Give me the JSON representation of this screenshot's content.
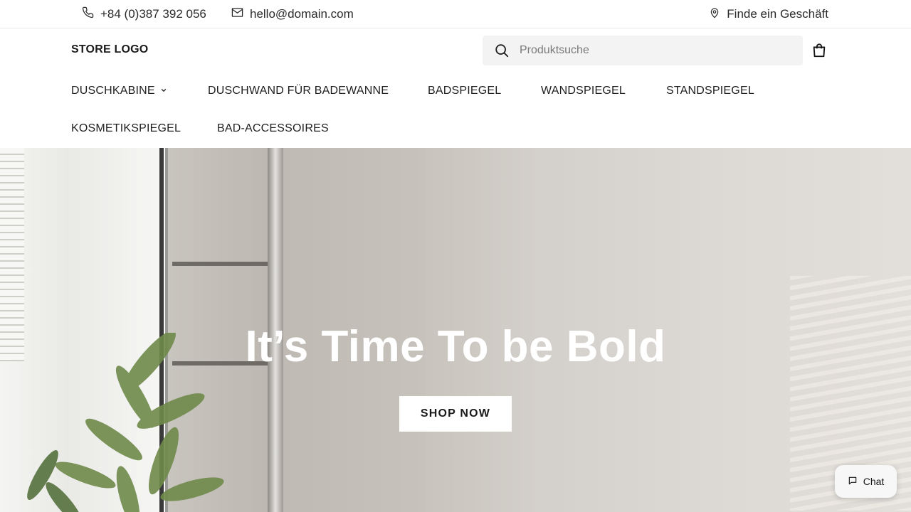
{
  "topbar": {
    "phone": "+84 (0)387 392 056",
    "email": "hello@domain.com",
    "store_finder": "Finde ein Geschäft"
  },
  "header": {
    "logo": "STORE LOGO",
    "search_placeholder": "Produktsuche"
  },
  "nav": {
    "items": [
      {
        "label": "DUSCHKABINE",
        "has_dropdown": true
      },
      {
        "label": "DUSCHWAND FÜR BADEWANNE"
      },
      {
        "label": "BADSPIEGEL"
      },
      {
        "label": "WANDSPIEGEL"
      },
      {
        "label": "STANDSPIEGEL"
      },
      {
        "label": "KOSMETIKSPIEGEL"
      },
      {
        "label": "BAD-ACCESSOIRES"
      }
    ]
  },
  "hero": {
    "title": "It’s Time To be Bold",
    "button": "SHOP NOW"
  },
  "chat": {
    "label": "Chat"
  },
  "icons": [
    "phone-icon",
    "mail-icon",
    "location-pin-icon",
    "search-icon",
    "shopping-bag-icon",
    "chevron-down-icon",
    "chat-bubble-icon"
  ]
}
